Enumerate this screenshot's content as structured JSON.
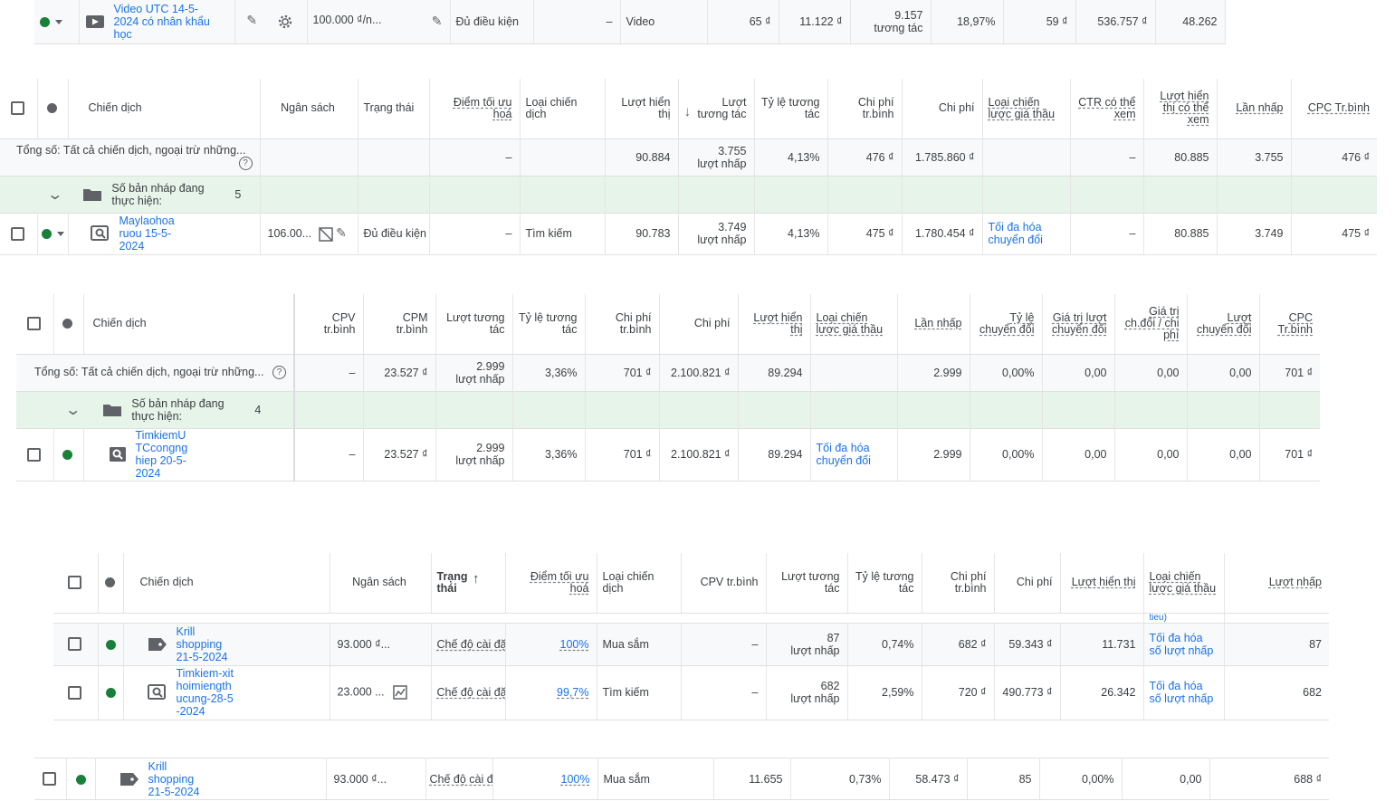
{
  "t1": {
    "name": "Video UTC 14-5-2024 có nhân khẩu học",
    "budget": "100.000 ₫/n...",
    "status": "Đủ điều kiện",
    "score": "–",
    "type": "Video",
    "c1": "65 ₫",
    "c2": "11.122 ₫",
    "c3": "9.157",
    "c3sub": "tương tác",
    "c4": "18,97%",
    "c5": "59 ₫",
    "c6": "536.757 ₫",
    "c7": "48.262"
  },
  "t2": {
    "headers": {
      "campaign": "Chiến dịch",
      "budget": "Ngân sách",
      "status": "Trạng thái",
      "score": "Điểm tối ưu hoá",
      "type": "Loại chiến dịch",
      "impr": "Lượt hiển thị",
      "interactions": "Lượt tương tác",
      "rate": "Tỷ lệ tương tác",
      "avgcost": "Chi phí tr.bình",
      "cost": "Chi phí",
      "bidstrategy": "Loại chiến lược giá thầu",
      "ctrview": "CTR có thể xem",
      "viewimpr": "Lượt hiển thị có thể xem",
      "clicks": "Lần nhấp",
      "cpc": "CPC Tr.bình"
    },
    "total": {
      "label": "Tổng số: Tất cả chiến dịch, ngoại trừ những...",
      "score": "–",
      "impr": "90.884",
      "inter": "3.755",
      "intersub": "lượt nhấp",
      "rate": "4,13%",
      "avgcost": "476 ₫",
      "cost": "1.785.860 ₫",
      "ctrview": "–",
      "viewimpr": "80.885",
      "clicks": "3.755",
      "cpc": "476 ₫"
    },
    "draft": {
      "label": "Số bản nháp đang thực hiện:",
      "count": "5"
    },
    "row": {
      "name": "Maylaohoa ruou 15-5-2024",
      "budget": "106.00...",
      "status": "Đủ điều kiện",
      "score": "–",
      "type": "Tìm kiếm",
      "impr": "90.783",
      "inter": "3.749",
      "intersub": "lượt nhấp",
      "rate": "4,13%",
      "avgcost": "475 ₫",
      "cost": "1.780.454 ₫",
      "bid": "Tối đa hóa chuyển đổi",
      "ctrview": "–",
      "viewimpr": "80.885",
      "clicks": "3.749",
      "cpc": "475 ₫"
    }
  },
  "t3": {
    "headers": {
      "campaign": "Chiến dịch",
      "cpv": "CPV tr.bình",
      "cpm": "CPM tr.bình",
      "inter": "Lượt tương tác",
      "rate": "Tỷ lệ tương tác",
      "avgcost": "Chi phí tr.bình",
      "cost": "Chi phí",
      "impr": "Lượt hiển thị",
      "bid": "Loại chiến lược giá thầu",
      "clicks": "Lần nhấp",
      "convrate": "Tỷ lệ chuyển đổi",
      "convvalue": "Giá trị lượt chuyển đổi",
      "valuecost": "Giá trị ch.đổi / chi phí",
      "conversions": "Lượt chuyển đổi",
      "cpc": "CPC Tr.bình"
    },
    "total": {
      "label": "Tổng số: Tất cả chiến dịch, ngoại trừ những...",
      "cpv": "–",
      "cpm": "23.527 ₫",
      "inter": "2.999",
      "intersub": "lượt nhấp",
      "rate": "3,36%",
      "avgcost": "701 ₫",
      "cost": "2.100.821 ₫",
      "impr": "89.294",
      "clicks": "2.999",
      "convrate": "0,00%",
      "convvalue": "0,00",
      "valuecost": "0,00",
      "conversions": "0,00",
      "cpc": "701 ₫"
    },
    "draft": {
      "label": "Số bản nháp đang thực hiện:",
      "count": "4"
    },
    "row": {
      "name": "TimkiemUTCcongnghiep 20-5-2024",
      "cpv": "–",
      "cpm": "23.527 ₫",
      "inter": "2.999",
      "intersub": "lượt nhấp",
      "rate": "3,36%",
      "avgcost": "701 ₫",
      "cost": "2.100.821 ₫",
      "impr": "89.294",
      "bid": "Tối đa hóa chuyển đổi",
      "clicks": "2.999",
      "convrate": "0,00%",
      "convvalue": "0,00",
      "valuecost": "0,00",
      "conversions": "0,00",
      "cpc": "701 ₫"
    }
  },
  "t4": {
    "headers": {
      "campaign": "Chiến dịch",
      "budget": "Ngân sách",
      "status": "Trạng thái",
      "score": "Điểm tối ưu hoá",
      "type": "Loại chiến dịch",
      "cpv": "CPV tr.bình",
      "inter": "Lượt tương tác",
      "rate": "Tỷ lệ tương tác",
      "avgcost": "Chi phí tr.bình",
      "cost": "Chi phí",
      "impr": "Lượt hiển thị",
      "bid": "Loại chiến lược giá thầu",
      "clicks": "Lượt nhấp"
    },
    "overlap": "tieu)",
    "rows": [
      {
        "name": "Krill shopping 21-5-2024",
        "budget": "93.000 ₫...",
        "status": "Chế độ cài đặ",
        "score": "100%",
        "type": "Mua sắm",
        "cpv": "–",
        "inter": "87",
        "intersub": "lượt nhấp",
        "rate": "0,74%",
        "avgcost": "682 ₫",
        "cost": "59.343 ₫",
        "impr": "11.731",
        "bid": "Tối đa hóa số lượt nhấp",
        "clicks": "87"
      },
      {
        "name": "Timkiem-xithoimiengthucung-28-5-2024",
        "budget": "23.000 ...",
        "status": "Chế độ cài đặ",
        "score": "99,7%",
        "type": "Tìm kiếm",
        "cpv": "–",
        "inter": "682",
        "intersub": "lượt nhấp",
        "rate": "2,59%",
        "avgcost": "720 ₫",
        "cost": "490.773 ₫",
        "impr": "26.342",
        "bid": "Tối đa hóa số lượt nhấp",
        "clicks": "682"
      }
    ]
  },
  "t5": {
    "name": "Krill shopping 21-5-2024",
    "budget": "93.000 ₫...",
    "status": "Chế độ cài đặ",
    "score": "100%",
    "type": "Mua sắm",
    "c1": "11.655",
    "c2": "0,73%",
    "c3": "58.473 ₫",
    "c4": "85",
    "c5": "0,00%",
    "c6": "0,00",
    "c7": "688 ₫"
  }
}
